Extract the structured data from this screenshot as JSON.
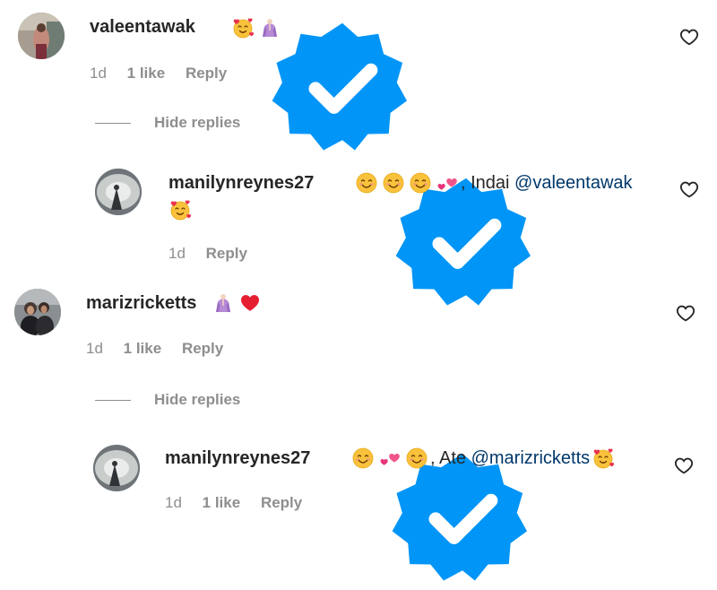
{
  "comments": [
    {
      "username": "valeentawak",
      "text_before": "",
      "mention": "",
      "text_after": "",
      "time": "1d",
      "likes": "1 like",
      "reply": "Reply",
      "hide_replies": "Hide replies"
    },
    {
      "username": "manilynreynes27",
      "text_before": ", Indai ",
      "mention": "@valeentawak",
      "time": "1d",
      "reply": "Reply"
    },
    {
      "username": "marizricketts",
      "time": "1d",
      "likes": "1 like",
      "reply": "Reply",
      "hide_replies": "Hide replies"
    },
    {
      "username": "manilynreynes27",
      "text_before": ", Ate ",
      "mention": "@marizricketts",
      "time": "1d",
      "likes": "1 like",
      "reply": "Reply"
    }
  ],
  "icons": {
    "verified": "verified-badge-icon",
    "like": "heart-outline-icon",
    "smiling": "smiling-face-emoji",
    "hearts_face": "smiling-face-with-hearts-emoji",
    "two_hearts": "two-hearts-emoji",
    "praying": "praying-person-emoji",
    "red_heart": "red-heart-emoji"
  },
  "colors": {
    "username": "#262626",
    "meta": "#8e8e8e",
    "mention": "#00376b",
    "verified": "#0095f6"
  }
}
